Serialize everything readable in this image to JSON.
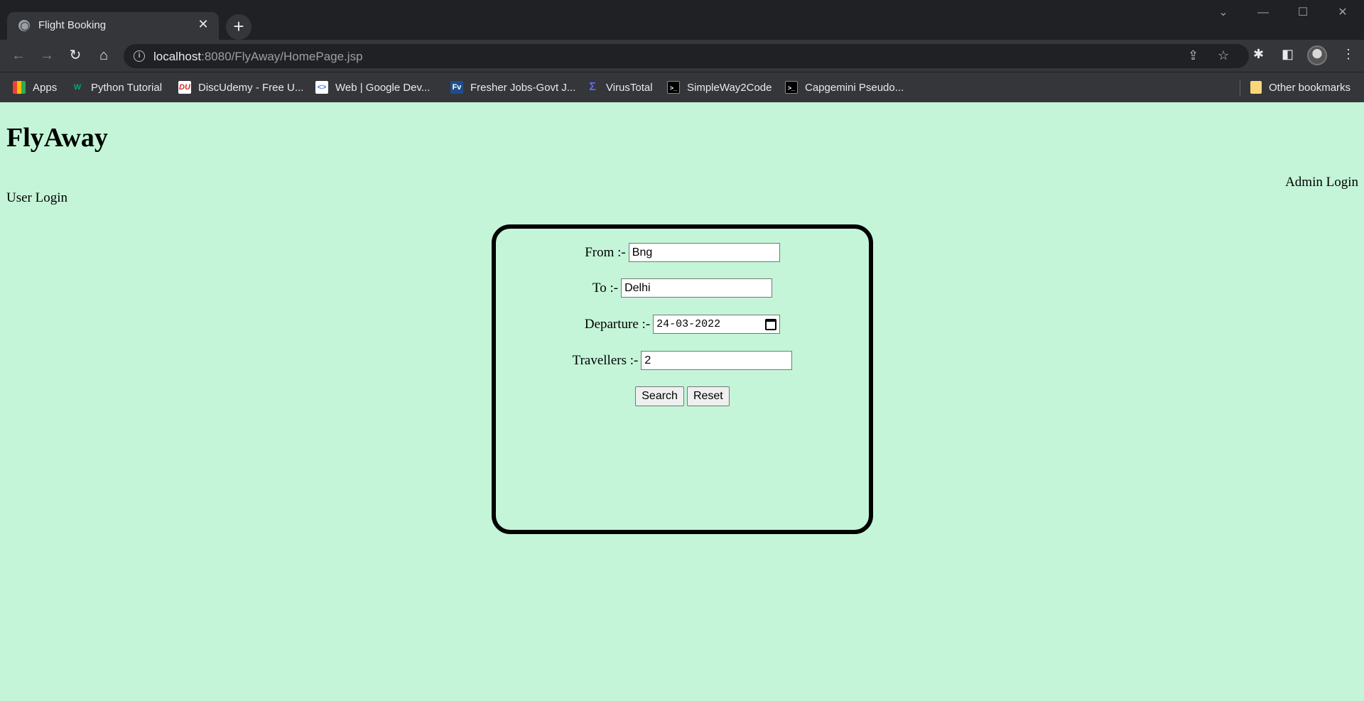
{
  "browser": {
    "tab_title": "Flight Booking",
    "tab_close": "✕",
    "new_tab": "+",
    "url_host": "localhost",
    "url_rest": ":8080/FlyAway/HomePage.jsp",
    "bookmarks": [
      {
        "label": "Apps",
        "icon": "apps-grid-icon"
      },
      {
        "label": "Python Tutorial",
        "icon": "w3schools-icon"
      },
      {
        "label": "DiscUdemy - Free U...",
        "icon": "discudemy-icon"
      },
      {
        "label": "Web | Google Dev...",
        "icon": "google-dev-icon"
      },
      {
        "label": "Fresher Jobs-Govt J...",
        "icon": "fv-icon"
      },
      {
        "label": "VirusTotal",
        "icon": "virustotal-icon"
      },
      {
        "label": "SimpleWay2Code",
        "icon": "terminal-icon"
      },
      {
        "label": "Capgemini Pseudo...",
        "icon": "terminal-icon"
      }
    ],
    "other_bookmarks": "Other bookmarks"
  },
  "page": {
    "brand": "FlyAway",
    "admin_login": "Admin Login",
    "user_login": "User Login",
    "form": {
      "from_label": "From :-",
      "from_value": "Bng",
      "to_label": "To :-",
      "to_value": "Delhi",
      "departure_label": "Departure :-",
      "departure_value": "24-03-2022",
      "travellers_label": "Travellers :-",
      "travellers_value": "2",
      "search_label": "Search",
      "reset_label": "Reset"
    }
  }
}
